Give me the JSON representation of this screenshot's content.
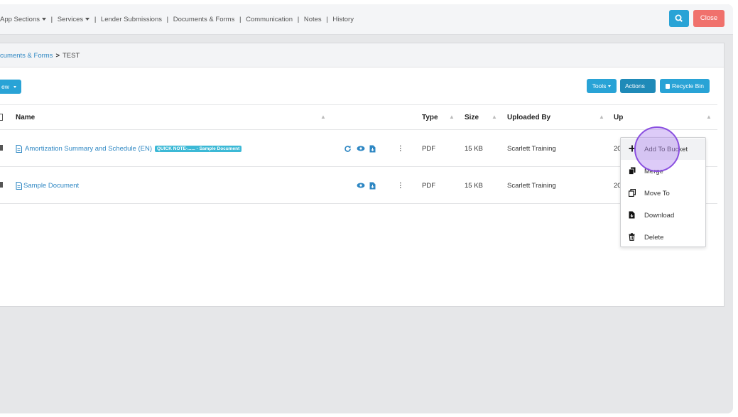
{
  "nav": {
    "app_sections": "App Sections",
    "services": "Services",
    "lender_submissions": "Lender Submissions",
    "documents_forms": "Documents & Forms",
    "communication": "Communication",
    "notes": "Notes",
    "history": "History",
    "separator": "|"
  },
  "header": {
    "close_label": "Close",
    "search_icon": "search-icon"
  },
  "breadcrumb": {
    "parent": "cuments & Forms",
    "separator": ">",
    "current": "TEST"
  },
  "toolbar": {
    "new_label": "ew",
    "tools_label": "Tools",
    "actions_label": "Actions",
    "recycle_label": "Recycle Bin"
  },
  "table": {
    "columns": {
      "name": "Name",
      "type": "Type",
      "size": "Size",
      "uploaded_by": "Uploaded By",
      "uploaded_on": "Up"
    },
    "rows": [
      {
        "name": "Amortization Summary and Schedule (EN)",
        "badge": "QUICK NOTE-...... - Sample Document",
        "type": "PDF",
        "size": "15 KB",
        "uploaded_by": "Scarlett Training",
        "date_partial": "20"
      },
      {
        "name": "Sample Document",
        "type": "PDF",
        "size": "15 KB",
        "uploaded_by": "Scarlett Training",
        "date_partial": "20"
      }
    ]
  },
  "actions_menu": {
    "items": [
      {
        "label": "Add To Bucket",
        "icon": "plus-icon"
      },
      {
        "label": "Merge",
        "icon": "copy-icon"
      },
      {
        "label": "Move To",
        "icon": "move-icon"
      },
      {
        "label": "Download",
        "icon": "download-file-icon"
      },
      {
        "label": "Delete",
        "icon": "trash-icon"
      }
    ]
  },
  "colors": {
    "primary": "#29a3d6",
    "danger": "#f0716c",
    "link": "#2e87c3",
    "cursor": "#8a4fe0"
  }
}
